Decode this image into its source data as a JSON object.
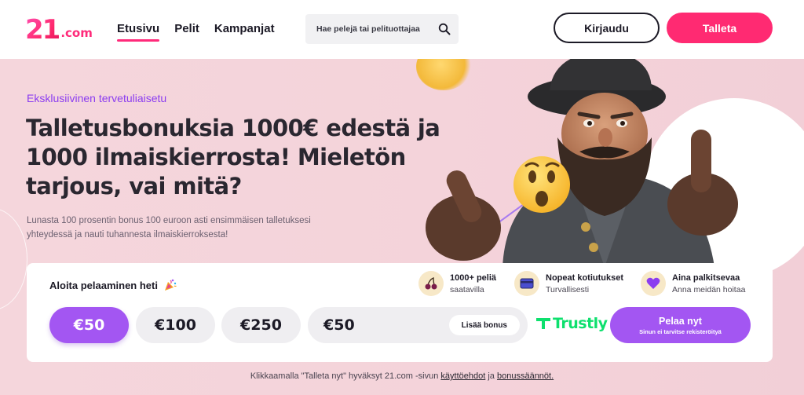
{
  "header": {
    "logo_big": "21",
    "logo_domain": ".com",
    "nav": [
      {
        "label": "Etusivu",
        "active": true
      },
      {
        "label": "Pelit",
        "active": false
      },
      {
        "label": "Kampanjat",
        "active": false
      }
    ],
    "search_placeholder": "Hae pelejä tai pelituottajaa",
    "login_label": "Kirjaudu",
    "deposit_label": "Talleta"
  },
  "hero": {
    "eyebrow": "Eksklusiivinen tervetuliaisetu",
    "headline": "Talletusbonuksia 1000€ edestä ja 1000 ilmaiskierrosta! Mieletön tarjous, vai mitä?",
    "subtext": "Lunasta 100 prosentin bonus 100 euroon asti ensimmäisen talletuksesi yhteydessä ja nauti tuhannesta ilmaiskierroksesta!"
  },
  "card": {
    "title": "Aloita pelaaminen heti",
    "features": [
      {
        "icon": "cherries-icon",
        "title": "1000+ peliä",
        "subtitle": "saatavilla"
      },
      {
        "icon": "card-icon",
        "title": "Nopeat kotiutukset",
        "subtitle": "Turvallisesti"
      },
      {
        "icon": "heart-icon",
        "title": "Aina palkitsevaa",
        "subtitle": "Anna meidän hoitaa"
      }
    ],
    "amounts": [
      "€50",
      "€100",
      "€250"
    ],
    "selected_amount_index": 0,
    "amount_value": "€50",
    "add_bonus_label": "Lisää bonus",
    "payment_provider": "Trustly",
    "play_label": "Pelaa nyt",
    "play_sublabel": "Sinun ei tarvitse rekisteröityä"
  },
  "footnote": {
    "prefix": "Klikkaamalla \"Talleta nyt\" hyväksyt 21.com -sivun",
    "terms_link": "käyttöehdot",
    "connector": "ja",
    "bonus_link": "bonussäännöt."
  },
  "colors": {
    "brand_pink": "#ff2a72",
    "accent_purple": "#a356f2",
    "eyebrow_purple": "#8b3df0",
    "trustly_green": "#0ee06e",
    "hero_bg": "#f4d3da"
  }
}
